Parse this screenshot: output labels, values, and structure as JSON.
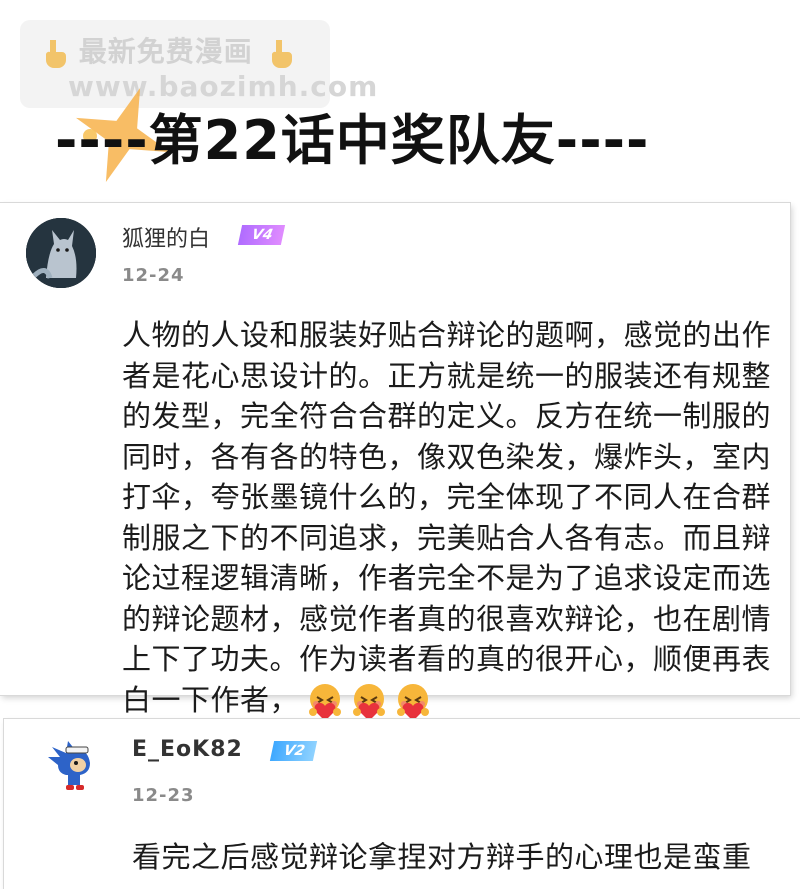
{
  "watermark": {
    "line1": "最新免费漫画",
    "line2": "www.baozimh.com",
    "icon": "pointing-hand-icon"
  },
  "chapter_title": "----第22话中奖队友----",
  "comments": [
    {
      "username": "狐狸的白",
      "badge": "V4",
      "badge_color": "#c27cff",
      "date": "12-24",
      "text": "人物的人设和服装好贴合辩论的题啊，感觉的出作者是花心思设计的。正方就是统一的服装还有规整的发型，完全符合合群的定义。反方在统一制服的同时，各有各的特色，像双色染发，爆炸头，室内打伞，夸张墨镜什么的，完全体现了不同人在合群制服之下的不同追求，完美贴合人各有志。而且辩论过程逻辑清晰，作者完全不是为了追求设定而选的辩论题材，感觉作者真的很喜欢辩论，也在剧情上下了功夫。作为读者看的真的很开心，顺便再表白一下作者，",
      "emoji": "heart-hug-emoji-icon",
      "emoji_count": 3
    },
    {
      "username": "E_EoK82",
      "badge": "V2",
      "badge_color": "#4fb3ff",
      "date": "12-23",
      "text": "看完之后感觉辩论拿捏对方辩手的心理也是蛮重"
    }
  ]
}
